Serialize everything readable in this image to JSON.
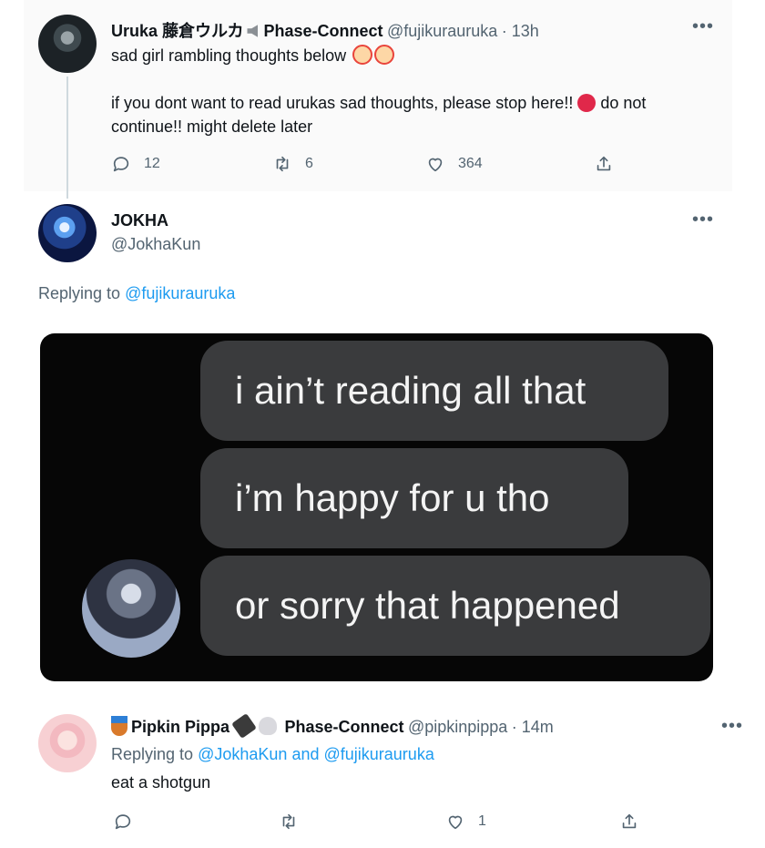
{
  "tweet_main": {
    "name": "Uruka 藤倉ウルカ",
    "name_suffix": "Phase-Connect",
    "handle": "@fujikurauruka",
    "time": "· 13h",
    "line1": "sad girl rambling thoughts below",
    "line2a": "if you dont want to read urukas sad thoughts, please stop here!!",
    "line2b": "do not",
    "line3": "continue!! might delete later",
    "more": "•••",
    "reply_count": "12",
    "retweet_count": "6",
    "like_count": "364"
  },
  "tweet_reply": {
    "name": "JOKHA",
    "handle": "@JokhaKun",
    "more": "•••",
    "replying_prefix": "Replying to",
    "replying_handle": "@fujikurauruka",
    "media": {
      "bubble1": "i ain’t reading all that",
      "bubble2": "i’m happy for u tho",
      "bubble3": "or sorry that happened"
    }
  },
  "tweet_third": {
    "name": "Pipkin Pippa",
    "name_suffix": "Phase-Connect",
    "handle": "@pipkinpippa",
    "time": "· 14m",
    "more": "•••",
    "replying_prefix": "Replying to",
    "replying_handle1": "@JokhaKun",
    "replying_and": "and",
    "replying_handle2": "@fujikurauruka",
    "text": "eat a shotgun",
    "like_count": "1"
  },
  "colors": {
    "link": "#1d9bf0",
    "muted": "#536471",
    "text": "#0f1419",
    "bubble": "#3a3b3d"
  }
}
